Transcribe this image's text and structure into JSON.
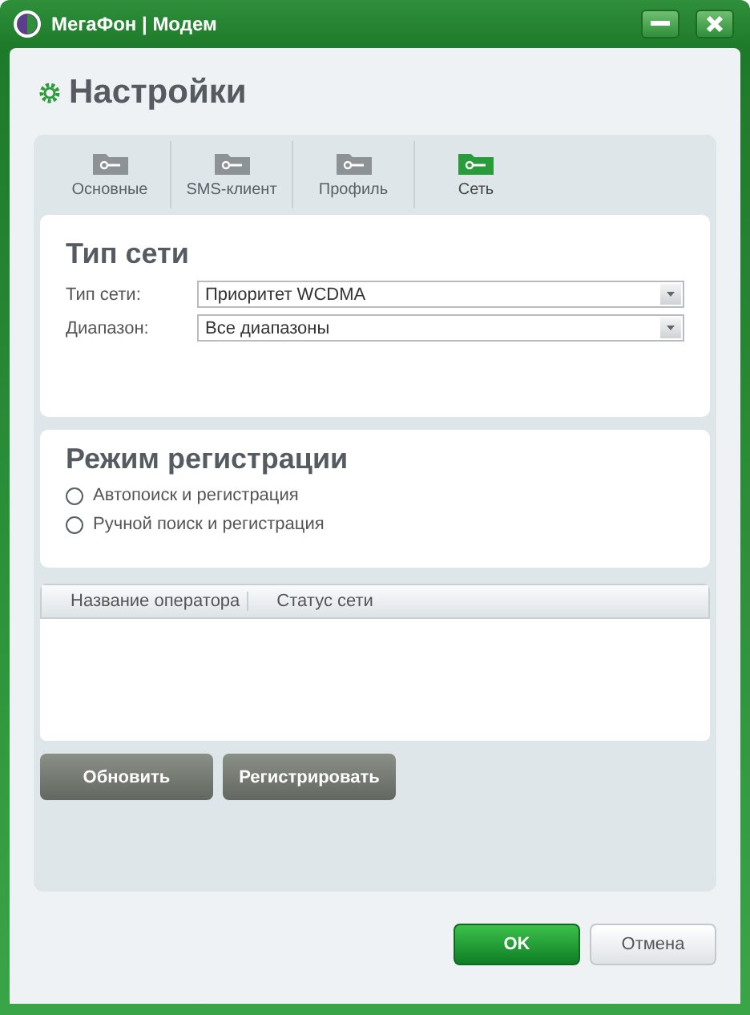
{
  "window": {
    "title": "МегаФон | Модем"
  },
  "page_title": "Настройки",
  "tabs": [
    {
      "label": "Основные",
      "selected": false
    },
    {
      "label": "SMS-клиент",
      "selected": false
    },
    {
      "label": "Профиль",
      "selected": false
    },
    {
      "label": "Сеть",
      "selected": true
    }
  ],
  "network_type": {
    "heading": "Тип сети",
    "fields": [
      {
        "label": "Тип сети:",
        "value": "Приоритет WCDMA"
      },
      {
        "label": "Диапазон:",
        "value": "Все диапазоны"
      }
    ]
  },
  "registration": {
    "heading": "Режим регистрации",
    "options": [
      {
        "label": "Автопоиск и регистрация",
        "selected": false
      },
      {
        "label": "Ручной поиск и регистрация",
        "selected": false
      }
    ]
  },
  "table": {
    "columns": [
      "Название оператора",
      "Статус сети"
    ]
  },
  "actions": [
    "Обновить",
    "Регистрировать"
  ],
  "buttons": [
    {
      "label": "OK",
      "kind": "primary"
    },
    {
      "label": "Отмена",
      "kind": "secondary"
    }
  ]
}
